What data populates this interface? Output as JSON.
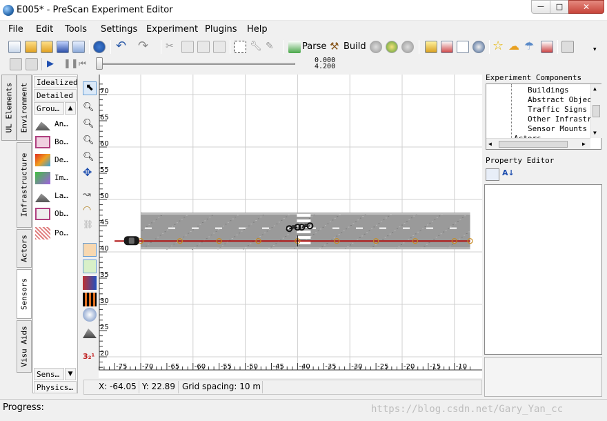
{
  "window": {
    "title": "E005* - PreScan Experiment Editor",
    "close_glyph": "✕",
    "minimize_glyph": "—",
    "maximize_glyph": "□"
  },
  "menu": [
    "File",
    "Edit",
    "Tools",
    "Settings",
    "Experiment",
    "Plugins",
    "Help"
  ],
  "toolbar": {
    "parse_label": "Parse",
    "build_label": "Build"
  },
  "timeline": {
    "value_top": "0.000",
    "value_bottom": "4.200"
  },
  "left_tabs": {
    "ul_elements": "UL Elements",
    "environment": "Environment",
    "infrastructure": "Infrastructure",
    "actors": "Actors",
    "sensors": "Sensors",
    "visu_aids": "Visu Aids"
  },
  "palette": {
    "idealized": "Idealized",
    "detailed": "Detailed",
    "group": "Grou…",
    "items": [
      "An…",
      "Bo…",
      "De…",
      "Im…",
      "La…",
      "Ob…",
      "Po…"
    ],
    "sensors_dropdown": "Sens…",
    "physics_dropdown": "Physics…"
  },
  "canvas": {
    "y_ticks": [
      "70",
      "65",
      "60",
      "55",
      "50",
      "45",
      "40",
      "35",
      "30",
      "25",
      "20"
    ],
    "x_ticks": [
      "-75",
      "-70",
      "-65",
      "-60",
      "-55",
      "-50",
      "-45",
      "-40",
      "-35",
      "-30",
      "-25",
      "-20",
      "-15",
      "-10"
    ]
  },
  "status": {
    "x": "X: -64.05",
    "y": "Y: 22.89",
    "grid": "Grid spacing: 10 m"
  },
  "experiment_components": {
    "title": "Experiment Components",
    "items": [
      "Buildings",
      "Abstract Object",
      "Traffic Signs",
      "Other Infrastru",
      "Sensor Mounts",
      "Actors"
    ]
  },
  "property_editor": {
    "title": "Property Editor"
  },
  "progress_label": "Progress:",
  "watermark": "https://blog.csdn.net/Gary_Yan_cc",
  "colors": {
    "trajectory": "#b01010",
    "road": "#9a9a9a",
    "grid": "#d0d0d0"
  }
}
